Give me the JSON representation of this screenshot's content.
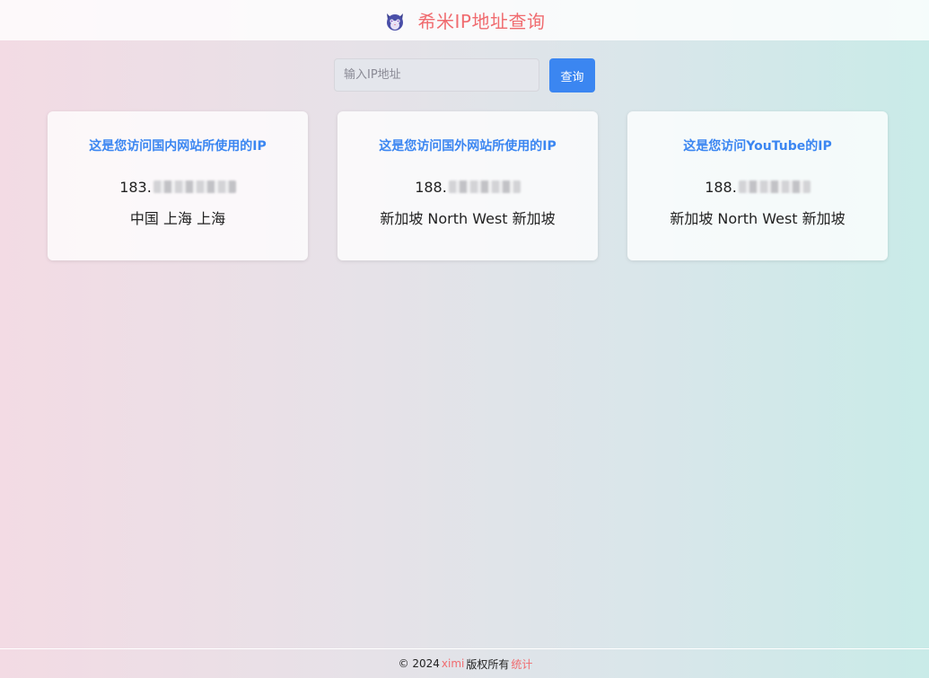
{
  "header": {
    "title": "希米IP地址查询",
    "logo_icon": "cat-logo-icon"
  },
  "search": {
    "placeholder": "输入IP地址",
    "value": "",
    "button_label": "查询"
  },
  "cards": [
    {
      "title": "这是您访问国内网站所使用的IP",
      "ip_prefix": "183.",
      "location": "中国 上海 上海"
    },
    {
      "title": "这是您访问国外网站所使用的IP",
      "ip_prefix": "188.",
      "location": "新加坡 North West 新加坡"
    },
    {
      "title": "这是您访问YouTube的IP",
      "ip_prefix": "188.",
      "location": "新加坡 North West 新加坡"
    }
  ],
  "footer": {
    "copyright": "© 2024",
    "brand": "ximi",
    "rights": "版权所有",
    "stats_link": "统计"
  },
  "colors": {
    "accent_blue": "#3b86f1",
    "brand_red": "#f06b6f"
  }
}
